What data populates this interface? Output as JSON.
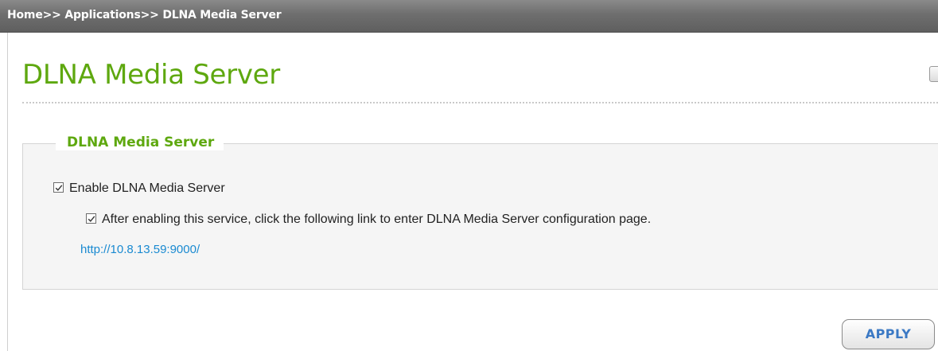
{
  "breadcrumb": "Home>> Applications>> DLNA Media Server",
  "page": {
    "title": "DLNA Media Server"
  },
  "section": {
    "legend": "DLNA Media Server",
    "enable_checkbox": {
      "label": "Enable DLNA Media Server",
      "checked": true
    },
    "config_checkbox": {
      "label": "After enabling this service, click the following link to enter DLNA Media Server configuration page.",
      "checked": true
    },
    "config_link": "http://10.8.13.59:9000/"
  },
  "actions": {
    "apply_label": "APPLY"
  },
  "colors": {
    "title_green": "#5ea80f",
    "link_blue": "#1a8ad1",
    "button_text_blue": "#3b79c4",
    "header_gray": "#6e6e6e"
  },
  "icons": {
    "check": "checkmark-icon",
    "help": "help-icon"
  }
}
